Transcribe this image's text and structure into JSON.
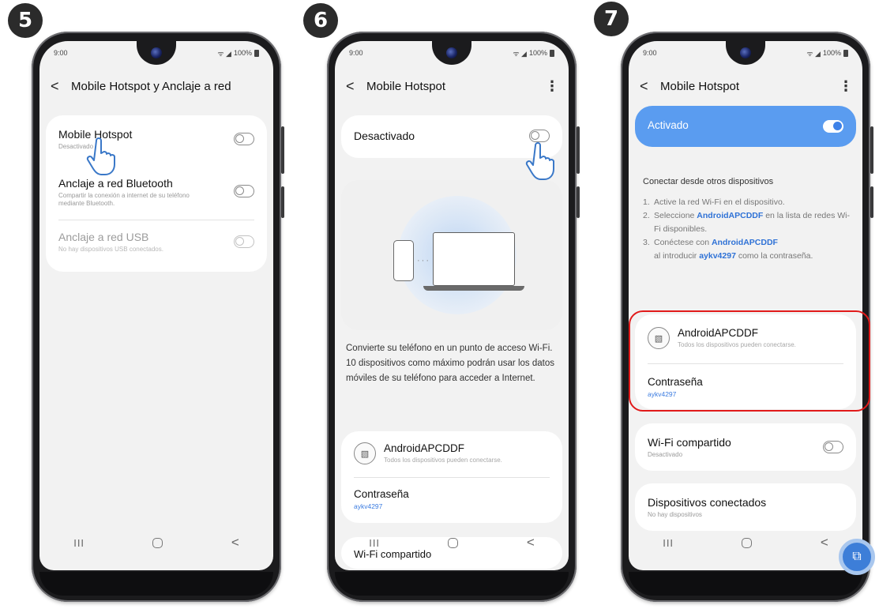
{
  "steps": [
    "5",
    "6",
    "7"
  ],
  "status": {
    "time": "9:00",
    "battery": "100%"
  },
  "screen5": {
    "title": "Mobile Hotspot y Anclaje a red",
    "items": [
      {
        "title": "Mobile Hotspot",
        "sub": "Desactivado"
      },
      {
        "title": "Anclaje a red Bluetooth",
        "sub": "Compartir la conexión a internet de su teléfono mediante Bluetooth."
      },
      {
        "title": "Anclaje a red USB",
        "sub": "No hay dispositivos USB conectados."
      }
    ]
  },
  "screen6": {
    "title": "Mobile Hotspot",
    "switch_label": "Desactivado",
    "description": "Convierte su teléfono en un punto de acceso Wi-Fi. 10 dispositivos como máximo podrán usar los datos móviles de su teléfono para acceder a Internet.",
    "network_name": "AndroidAPCDDF",
    "network_sub": "Todos los dispositivos pueden conectarse.",
    "password_label": "Contraseña",
    "password_value": "aykv4297",
    "cut_item": "Wi-Fi compartido"
  },
  "screen7": {
    "title": "Mobile Hotspot",
    "switch_label": "Activado",
    "connect_heading": "Conectar desde otros dispositivos",
    "steps": [
      {
        "n": "1.",
        "pre": "Active la red Wi-Fi en el dispositivo.",
        "bold": "",
        "post": ""
      },
      {
        "n": "2.",
        "pre": "Seleccione ",
        "bold": "AndroidAPCDDF",
        "post": " en la lista de redes Wi-Fi disponibles."
      },
      {
        "n": "3.",
        "pre": "Conéctese con ",
        "bold": "AndroidAPCDDF",
        "post": ""
      }
    ],
    "step3_line2_pre": "al introducir ",
    "step3_line2_bold": "aykv4297",
    "step3_line2_post": " como la contraseña.",
    "network_name": "AndroidAPCDDF",
    "network_sub": "Todos los dispositivos pueden conectarse.",
    "password_label": "Contraseña",
    "password_value": "aykv4297",
    "wifi_shared_title": "Wi-Fi compartido",
    "wifi_shared_sub": "Desactivado",
    "connected_title": "Dispositivos conectados",
    "connected_sub": "No hay dispositivos"
  },
  "icons": {
    "back": "back-chevron-icon",
    "more": "more-vertical-icon",
    "hand": "pointing-hand-icon",
    "hotspot": "hotspot-network-icon",
    "nav_recent": "recent-apps-icon",
    "nav_home": "home-icon",
    "nav_back": "nav-back-icon"
  },
  "colors": {
    "accent": "#3e82e8",
    "activado_bg": "#5a9cf0",
    "highlight": "#e11a1a",
    "badge": "#2b2b2b"
  }
}
